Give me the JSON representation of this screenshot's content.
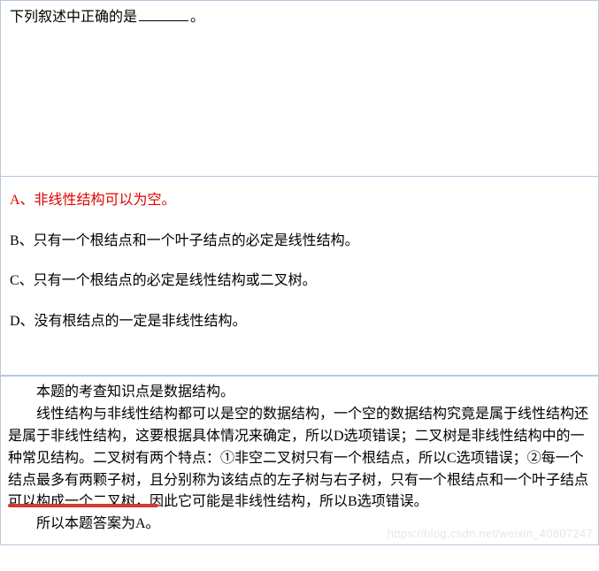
{
  "question": {
    "prefix": "下列叙述中正确的是",
    "suffix": "。"
  },
  "options": {
    "a": "A、非线性结构可以为空。",
    "b": "B、只有一个根结点和一个叶子结点的必定是线性结构。",
    "c": "C、只有一个根结点的必定是线性结构或二叉树。",
    "d": "D、没有根结点的一定是非线性结构。"
  },
  "explanation": {
    "p1": "本题的考查知识点是数据结构。",
    "p2": "线性结构与非线性结构都可以是空的数据结构，一个空的数据结构究竟是属于线性结构还是属于非线性结构，这要根据具体情况来确定，所以D选项错误；二叉树是非线性结构中的一种常见结构。二叉树有两个特点：①非空二叉树只有一个根结点，所以C选项错误；②每一个结点最多有两颗子树，且分别称为该结点的左子树与右子树，只有一个根结点和一个叶子结点可以构成一个二叉树，因此它可能是非线性结构，所以B选项错误。",
    "p3": "所以本题答案为A。"
  },
  "watermark": "https://blog.csdn.net/weixin_40807247"
}
